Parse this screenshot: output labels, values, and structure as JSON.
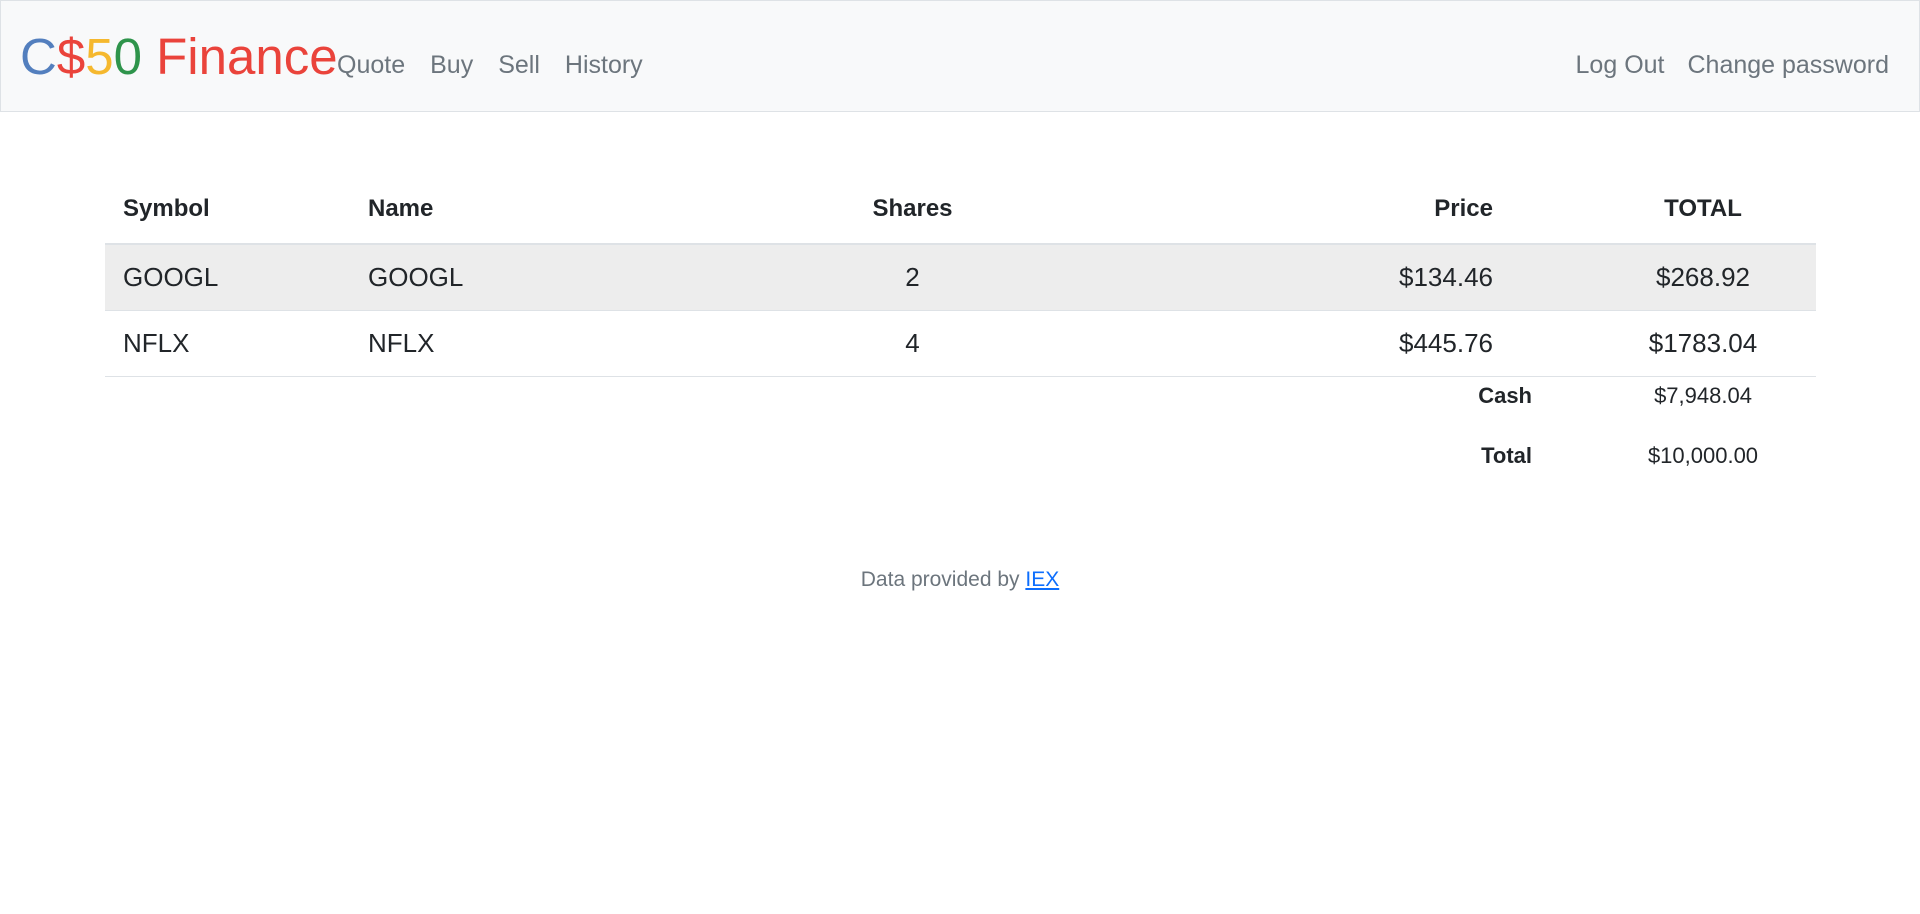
{
  "brand": {
    "parts": [
      {
        "text": "C",
        "color": "#537fbe"
      },
      {
        "text": "$",
        "color": "#ea433b"
      },
      {
        "text": "5",
        "color": "#f5b82e"
      },
      {
        "text": "0",
        "color": "#2e944b"
      },
      {
        "text": " Finance",
        "color": "#ea433b"
      }
    ]
  },
  "nav": {
    "left": [
      "Quote",
      "Buy",
      "Sell",
      "History"
    ],
    "right": [
      "Log Out",
      "Change password"
    ]
  },
  "table": {
    "headers": {
      "symbol": "Symbol",
      "name": "Name",
      "shares": "Shares",
      "price": "Price",
      "total": "TOTAL"
    },
    "rows": [
      {
        "symbol": "GOOGL",
        "name": "GOOGL",
        "shares": "2",
        "price": "$134.46",
        "total": "$268.92"
      },
      {
        "symbol": "NFLX",
        "name": "NFLX",
        "shares": "4",
        "price": "$445.76",
        "total": "$1783.04"
      }
    ],
    "cash_label": "Cash",
    "cash_value": "$7,948.04",
    "total_label": "Total",
    "total_value": "$10,000.00"
  },
  "footer": {
    "prefix": "Data provided by ",
    "link_text": "IEX"
  },
  "colors": {
    "navbar_bg": "#f8f9fa",
    "stripe_bg": "#ededed",
    "nav_link": "#6c757d",
    "link": "#0d6efd"
  }
}
